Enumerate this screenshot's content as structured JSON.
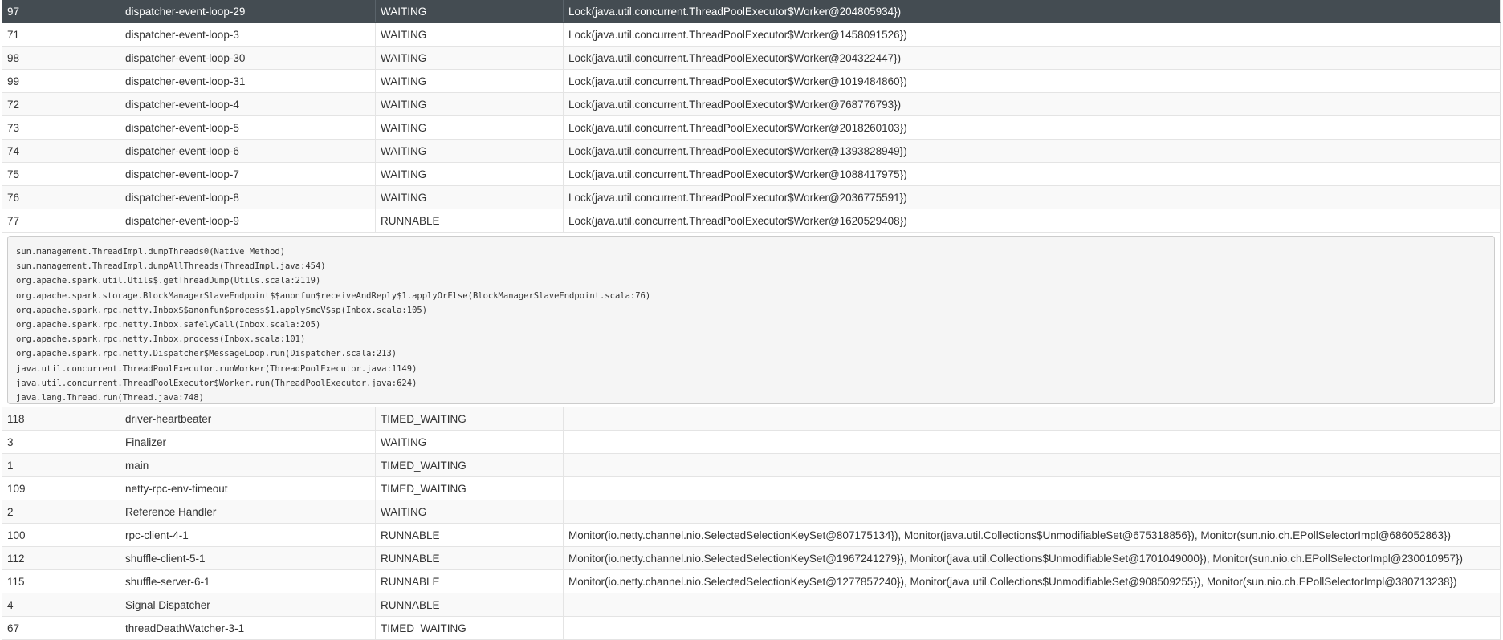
{
  "rows_top": [
    {
      "id": "97",
      "name": "dispatcher-event-loop-29",
      "state": "WAITING",
      "lock": "Lock(java.util.concurrent.ThreadPoolExecutor$Worker@204805934})",
      "selected": true
    },
    {
      "id": "71",
      "name": "dispatcher-event-loop-3",
      "state": "WAITING",
      "lock": "Lock(java.util.concurrent.ThreadPoolExecutor$Worker@1458091526})"
    },
    {
      "id": "98",
      "name": "dispatcher-event-loop-30",
      "state": "WAITING",
      "lock": "Lock(java.util.concurrent.ThreadPoolExecutor$Worker@204322447})"
    },
    {
      "id": "99",
      "name": "dispatcher-event-loop-31",
      "state": "WAITING",
      "lock": "Lock(java.util.concurrent.ThreadPoolExecutor$Worker@1019484860})"
    },
    {
      "id": "72",
      "name": "dispatcher-event-loop-4",
      "state": "WAITING",
      "lock": "Lock(java.util.concurrent.ThreadPoolExecutor$Worker@768776793})"
    },
    {
      "id": "73",
      "name": "dispatcher-event-loop-5",
      "state": "WAITING",
      "lock": "Lock(java.util.concurrent.ThreadPoolExecutor$Worker@2018260103})"
    },
    {
      "id": "74",
      "name": "dispatcher-event-loop-6",
      "state": "WAITING",
      "lock": "Lock(java.util.concurrent.ThreadPoolExecutor$Worker@1393828949})"
    },
    {
      "id": "75",
      "name": "dispatcher-event-loop-7",
      "state": "WAITING",
      "lock": "Lock(java.util.concurrent.ThreadPoolExecutor$Worker@1088417975})"
    },
    {
      "id": "76",
      "name": "dispatcher-event-loop-8",
      "state": "WAITING",
      "lock": "Lock(java.util.concurrent.ThreadPoolExecutor$Worker@2036775591})"
    },
    {
      "id": "77",
      "name": "dispatcher-event-loop-9",
      "state": "RUNNABLE",
      "lock": "Lock(java.util.concurrent.ThreadPoolExecutor$Worker@1620529408})"
    }
  ],
  "stack_trace": [
    "sun.management.ThreadImpl.dumpThreads0(Native Method)",
    "sun.management.ThreadImpl.dumpAllThreads(ThreadImpl.java:454)",
    "org.apache.spark.util.Utils$.getThreadDump(Utils.scala:2119)",
    "org.apache.spark.storage.BlockManagerSlaveEndpoint$$anonfun$receiveAndReply$1.applyOrElse(BlockManagerSlaveEndpoint.scala:76)",
    "org.apache.spark.rpc.netty.Inbox$$anonfun$process$1.apply$mcV$sp(Inbox.scala:105)",
    "org.apache.spark.rpc.netty.Inbox.safelyCall(Inbox.scala:205)",
    "org.apache.spark.rpc.netty.Inbox.process(Inbox.scala:101)",
    "org.apache.spark.rpc.netty.Dispatcher$MessageLoop.run(Dispatcher.scala:213)",
    "java.util.concurrent.ThreadPoolExecutor.runWorker(ThreadPoolExecutor.java:1149)",
    "java.util.concurrent.ThreadPoolExecutor$Worker.run(ThreadPoolExecutor.java:624)",
    "java.lang.Thread.run(Thread.java:748)"
  ],
  "rows_bottom": [
    {
      "id": "118",
      "name": "driver-heartbeater",
      "state": "TIMED_WAITING",
      "lock": ""
    },
    {
      "id": "3",
      "name": "Finalizer",
      "state": "WAITING",
      "lock": ""
    },
    {
      "id": "1",
      "name": "main",
      "state": "TIMED_WAITING",
      "lock": ""
    },
    {
      "id": "109",
      "name": "netty-rpc-env-timeout",
      "state": "TIMED_WAITING",
      "lock": ""
    },
    {
      "id": "2",
      "name": "Reference Handler",
      "state": "WAITING",
      "lock": ""
    },
    {
      "id": "100",
      "name": "rpc-client-4-1",
      "state": "RUNNABLE",
      "lock": "Monitor(io.netty.channel.nio.SelectedSelectionKeySet@807175134}), Monitor(java.util.Collections$UnmodifiableSet@675318856}), Monitor(sun.nio.ch.EPollSelectorImpl@686052863})"
    },
    {
      "id": "112",
      "name": "shuffle-client-5-1",
      "state": "RUNNABLE",
      "lock": "Monitor(io.netty.channel.nio.SelectedSelectionKeySet@1967241279}), Monitor(java.util.Collections$UnmodifiableSet@1701049000}), Monitor(sun.nio.ch.EPollSelectorImpl@230010957})"
    },
    {
      "id": "115",
      "name": "shuffle-server-6-1",
      "state": "RUNNABLE",
      "lock": "Monitor(io.netty.channel.nio.SelectedSelectionKeySet@1277857240}), Monitor(java.util.Collections$UnmodifiableSet@908509255}), Monitor(sun.nio.ch.EPollSelectorImpl@380713238})"
    },
    {
      "id": "4",
      "name": "Signal Dispatcher",
      "state": "RUNNABLE",
      "lock": ""
    },
    {
      "id": "67",
      "name": "threadDeathWatcher-3-1",
      "state": "TIMED_WAITING",
      "lock": ""
    }
  ]
}
